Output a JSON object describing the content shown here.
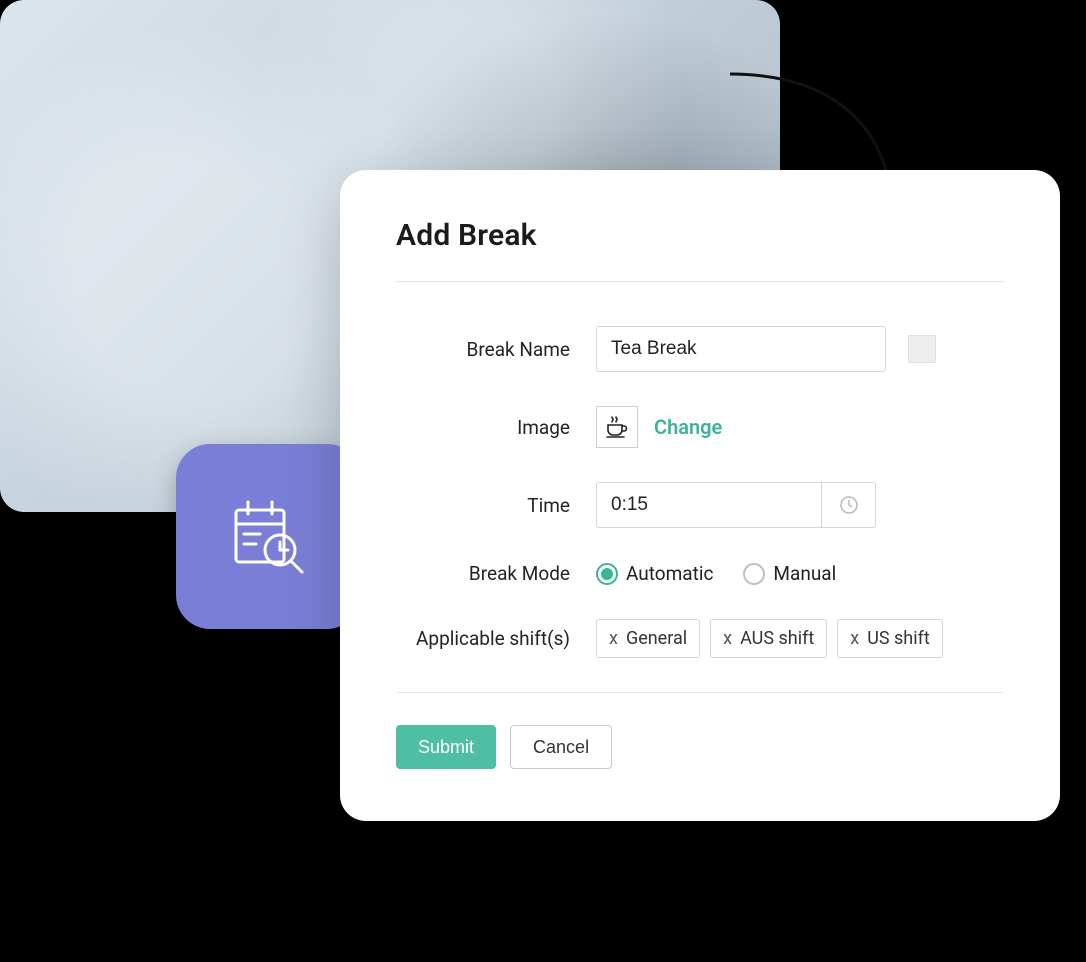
{
  "card": {
    "title": "Add Break",
    "labels": {
      "break_name": "Break Name",
      "image": "Image",
      "time": "Time",
      "break_mode": "Break Mode",
      "shifts": "Applicable shift(s)"
    },
    "break_name_value": "Tea Break",
    "image_icon": "coffee-cup-icon",
    "image_change_label": "Change",
    "time_value": "0:15",
    "break_mode_options": [
      "Automatic",
      "Manual"
    ],
    "break_mode_selected": "Automatic",
    "shifts": [
      "General",
      "AUS shift",
      "US shift"
    ],
    "actions": {
      "submit": "Submit",
      "cancel": "Cancel"
    }
  },
  "colors": {
    "accent": "#4fbfa3",
    "badge": "#7a7ed6"
  }
}
